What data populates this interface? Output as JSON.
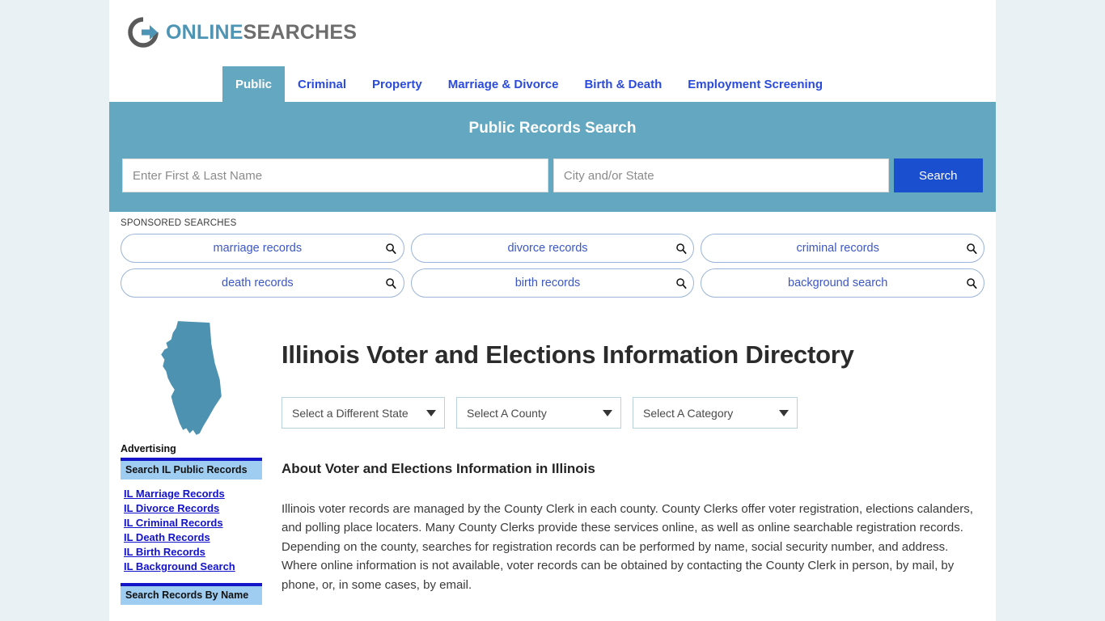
{
  "brand": {
    "name_part1": "ONLINE",
    "name_part2": "SEARCHES",
    "logo_icon": "circle-arrow-right-icon",
    "accent_teal": "#64a7c0",
    "accent_blue": "#1a4fd0",
    "link_blue": "#2a4bdb"
  },
  "nav": {
    "items": [
      {
        "label": "Public",
        "active": true
      },
      {
        "label": "Criminal",
        "active": false
      },
      {
        "label": "Property",
        "active": false
      },
      {
        "label": "Marriage & Divorce",
        "active": false
      },
      {
        "label": "Birth & Death",
        "active": false
      },
      {
        "label": "Employment Screening",
        "active": false
      }
    ]
  },
  "search": {
    "title": "Public Records Search",
    "name_placeholder": "Enter First & Last Name",
    "name_value": "",
    "city_placeholder": "City and/or State",
    "city_value": "",
    "button_label": "Search"
  },
  "sponsored": {
    "label": "SPONSORED SEARCHES",
    "icon": "search-icon",
    "rows": [
      [
        "marriage records",
        "divorce records",
        "criminal records"
      ],
      [
        "death records",
        "birth records",
        "background search"
      ]
    ]
  },
  "sidebar": {
    "map_icon": "illinois-state-map-icon",
    "advertising_label": "Advertising",
    "ad_block_1_heading": "Search IL Public Records",
    "ad_links": [
      "IL Marriage Records",
      "IL Divorce Records",
      "IL Criminal Records",
      "IL Death Records",
      "IL Birth Records",
      "IL Background Search"
    ],
    "ad_block_2_heading": "Search Records By Name"
  },
  "main": {
    "page_title": "Illinois Voter and Elections Information Directory",
    "selects": [
      {
        "label": "Select a Different State"
      },
      {
        "label": "Select A County"
      },
      {
        "label": "Select A Category"
      }
    ],
    "section_heading": "About Voter and Elections Information in Illinois",
    "paragraph": "Illinois voter records are managed by the County Clerk in each county. County Clerks offer voter registration, elections calanders, and polling place locaters. Many County Clerks provide these services online, as well as online searchable registration records. Depending on the county, searches for registration records can be performed by name, social security number, and address. Where online information is not available, voter records can be obtained by contacting the County Clerk in person, by mail, by phone, or, in some cases, by email."
  }
}
